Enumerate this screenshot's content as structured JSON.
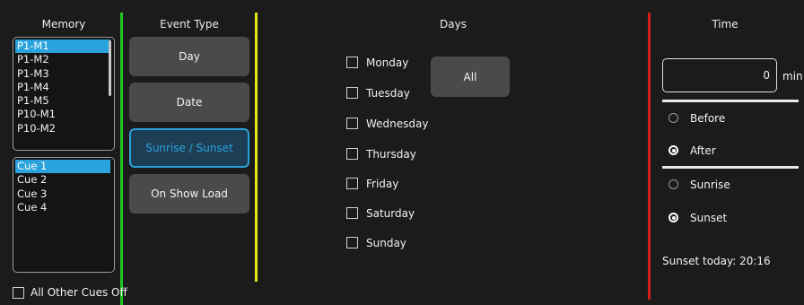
{
  "headers": {
    "memory": "Memory",
    "event_type": "Event Type",
    "days": "Days",
    "time": "Time"
  },
  "colors": {
    "green_divider": "#22c322",
    "yellow_divider": "#e6e619",
    "red_divider": "#d21e1e",
    "accent": "#2aa3dd"
  },
  "memory_list": {
    "items": [
      "P1-M1",
      "P1-M2",
      "P1-M3",
      "P1-M4",
      "P1-M5",
      "P10-M1",
      "P10-M2"
    ],
    "selected": "P1-M1"
  },
  "cue_list": {
    "items": [
      "Cue 1",
      "Cue 2",
      "Cue 3",
      "Cue 4"
    ],
    "selected": "Cue 1"
  },
  "all_other_cues_off": {
    "label": "All Other Cues Off",
    "checked": false
  },
  "event_types": [
    {
      "label": "Day",
      "active": false
    },
    {
      "label": "Date",
      "active": false
    },
    {
      "label": "Sunrise / Sunset",
      "active": true
    },
    {
      "label": "On Show Load",
      "active": false
    }
  ],
  "days": {
    "items": [
      {
        "label": "Monday",
        "checked": false
      },
      {
        "label": "Tuesday",
        "checked": false
      },
      {
        "label": "Wednesday",
        "checked": false
      },
      {
        "label": "Thursday",
        "checked": false
      },
      {
        "label": "Friday",
        "checked": false
      },
      {
        "label": "Saturday",
        "checked": false
      },
      {
        "label": "Sunday",
        "checked": false
      }
    ],
    "all_button": "All"
  },
  "time": {
    "offset_value": "0",
    "offset_unit": "min",
    "relation_options": [
      {
        "label": "Before",
        "selected": false
      },
      {
        "label": "After",
        "selected": true
      }
    ],
    "event_options": [
      {
        "label": "Sunrise",
        "selected": false
      },
      {
        "label": "Sunset",
        "selected": true
      }
    ],
    "sunset_today": "Sunset today: 20:16"
  }
}
